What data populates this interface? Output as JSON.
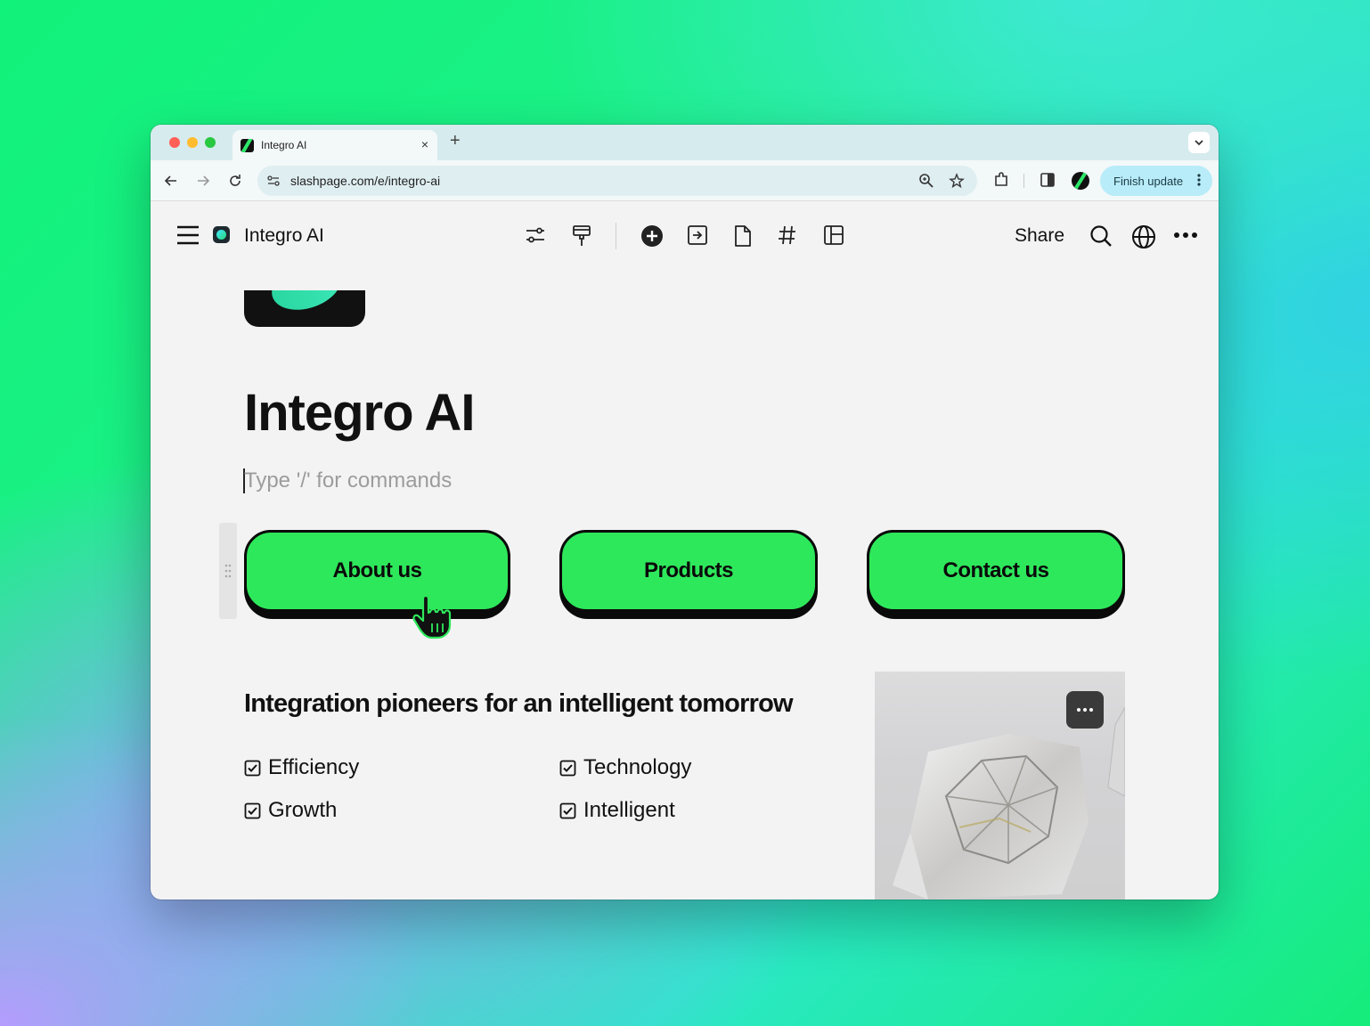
{
  "browser": {
    "tab_title": "Integro AI",
    "tab_close": "×",
    "new_tab": "+",
    "url": "slashpage.com/e/integro-ai",
    "finish_update_label": "Finish update",
    "icons": [
      "back-icon",
      "forward-icon",
      "reload-icon",
      "site-settings-icon",
      "zoom-icon",
      "bookmark-star-icon",
      "extensions-icon",
      "side-panel-icon",
      "profile-avatar",
      "kebab-menu-icon",
      "tab-search-chevron-icon"
    ]
  },
  "appbar": {
    "app_name": "Integro AI",
    "share_label": "Share",
    "icons": [
      "menu-icon",
      "settings-sliders-icon",
      "paint-roller-icon",
      "add-icon",
      "import-icon",
      "page-icon",
      "hashtag-icon",
      "layout-icon",
      "search-icon",
      "globe-icon",
      "more-icon"
    ]
  },
  "page": {
    "title": "Integro AI",
    "command_placeholder": "Type '/' for commands",
    "buttons": [
      {
        "label": "About us"
      },
      {
        "label": "Products"
      },
      {
        "label": "Contact us"
      }
    ],
    "section_heading": "Integration pioneers for an intelligent tomorrow",
    "features": [
      {
        "label": "Efficiency",
        "checked": true
      },
      {
        "label": "Technology",
        "checked": true
      },
      {
        "label": "Growth",
        "checked": true
      },
      {
        "label": "Intelligent",
        "checked": true
      }
    ]
  },
  "colors": {
    "button_green": "#2ee85b",
    "button_border": "#0a0a0a",
    "page_bg": "#f3f3f3",
    "finish_update_bg": "#b8ecf8"
  }
}
